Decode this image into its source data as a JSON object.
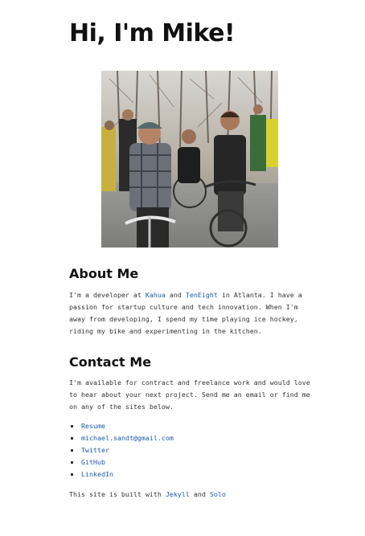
{
  "header": {
    "title": "Hi, I'm Mike!"
  },
  "photo": {
    "alt": "Mike with friends on bicycles"
  },
  "about": {
    "heading": "About Me",
    "intro_1": "I'm a developer at ",
    "link_kahua": "Kahua",
    "and": " and ",
    "link_teneight": "TenEight",
    "intro_2": " in Atlanta. I have a passion for startup culture and tech innovation. When I'm away from developing, I spend my time playing ice hockey, riding my bike and experimenting in the kitchen."
  },
  "contact": {
    "heading": "Contact Me",
    "text": "I'm available for contract and freelance work and would love to hear about your next project. Send me an email or find me on any of the sites below.",
    "links": [
      {
        "label": "Resume"
      },
      {
        "label": "michael.sandt@gmail.com"
      },
      {
        "label": "Twitter"
      },
      {
        "label": "GitHub"
      },
      {
        "label": "LinkedIn"
      }
    ]
  },
  "footer": {
    "prefix": "This site is built with ",
    "link_jekyll": "Jekyll",
    "and": " and ",
    "link_solo": "Solo"
  },
  "colors": {
    "link": "#1a5ba8",
    "heading": "#111111",
    "text": "#333333"
  }
}
